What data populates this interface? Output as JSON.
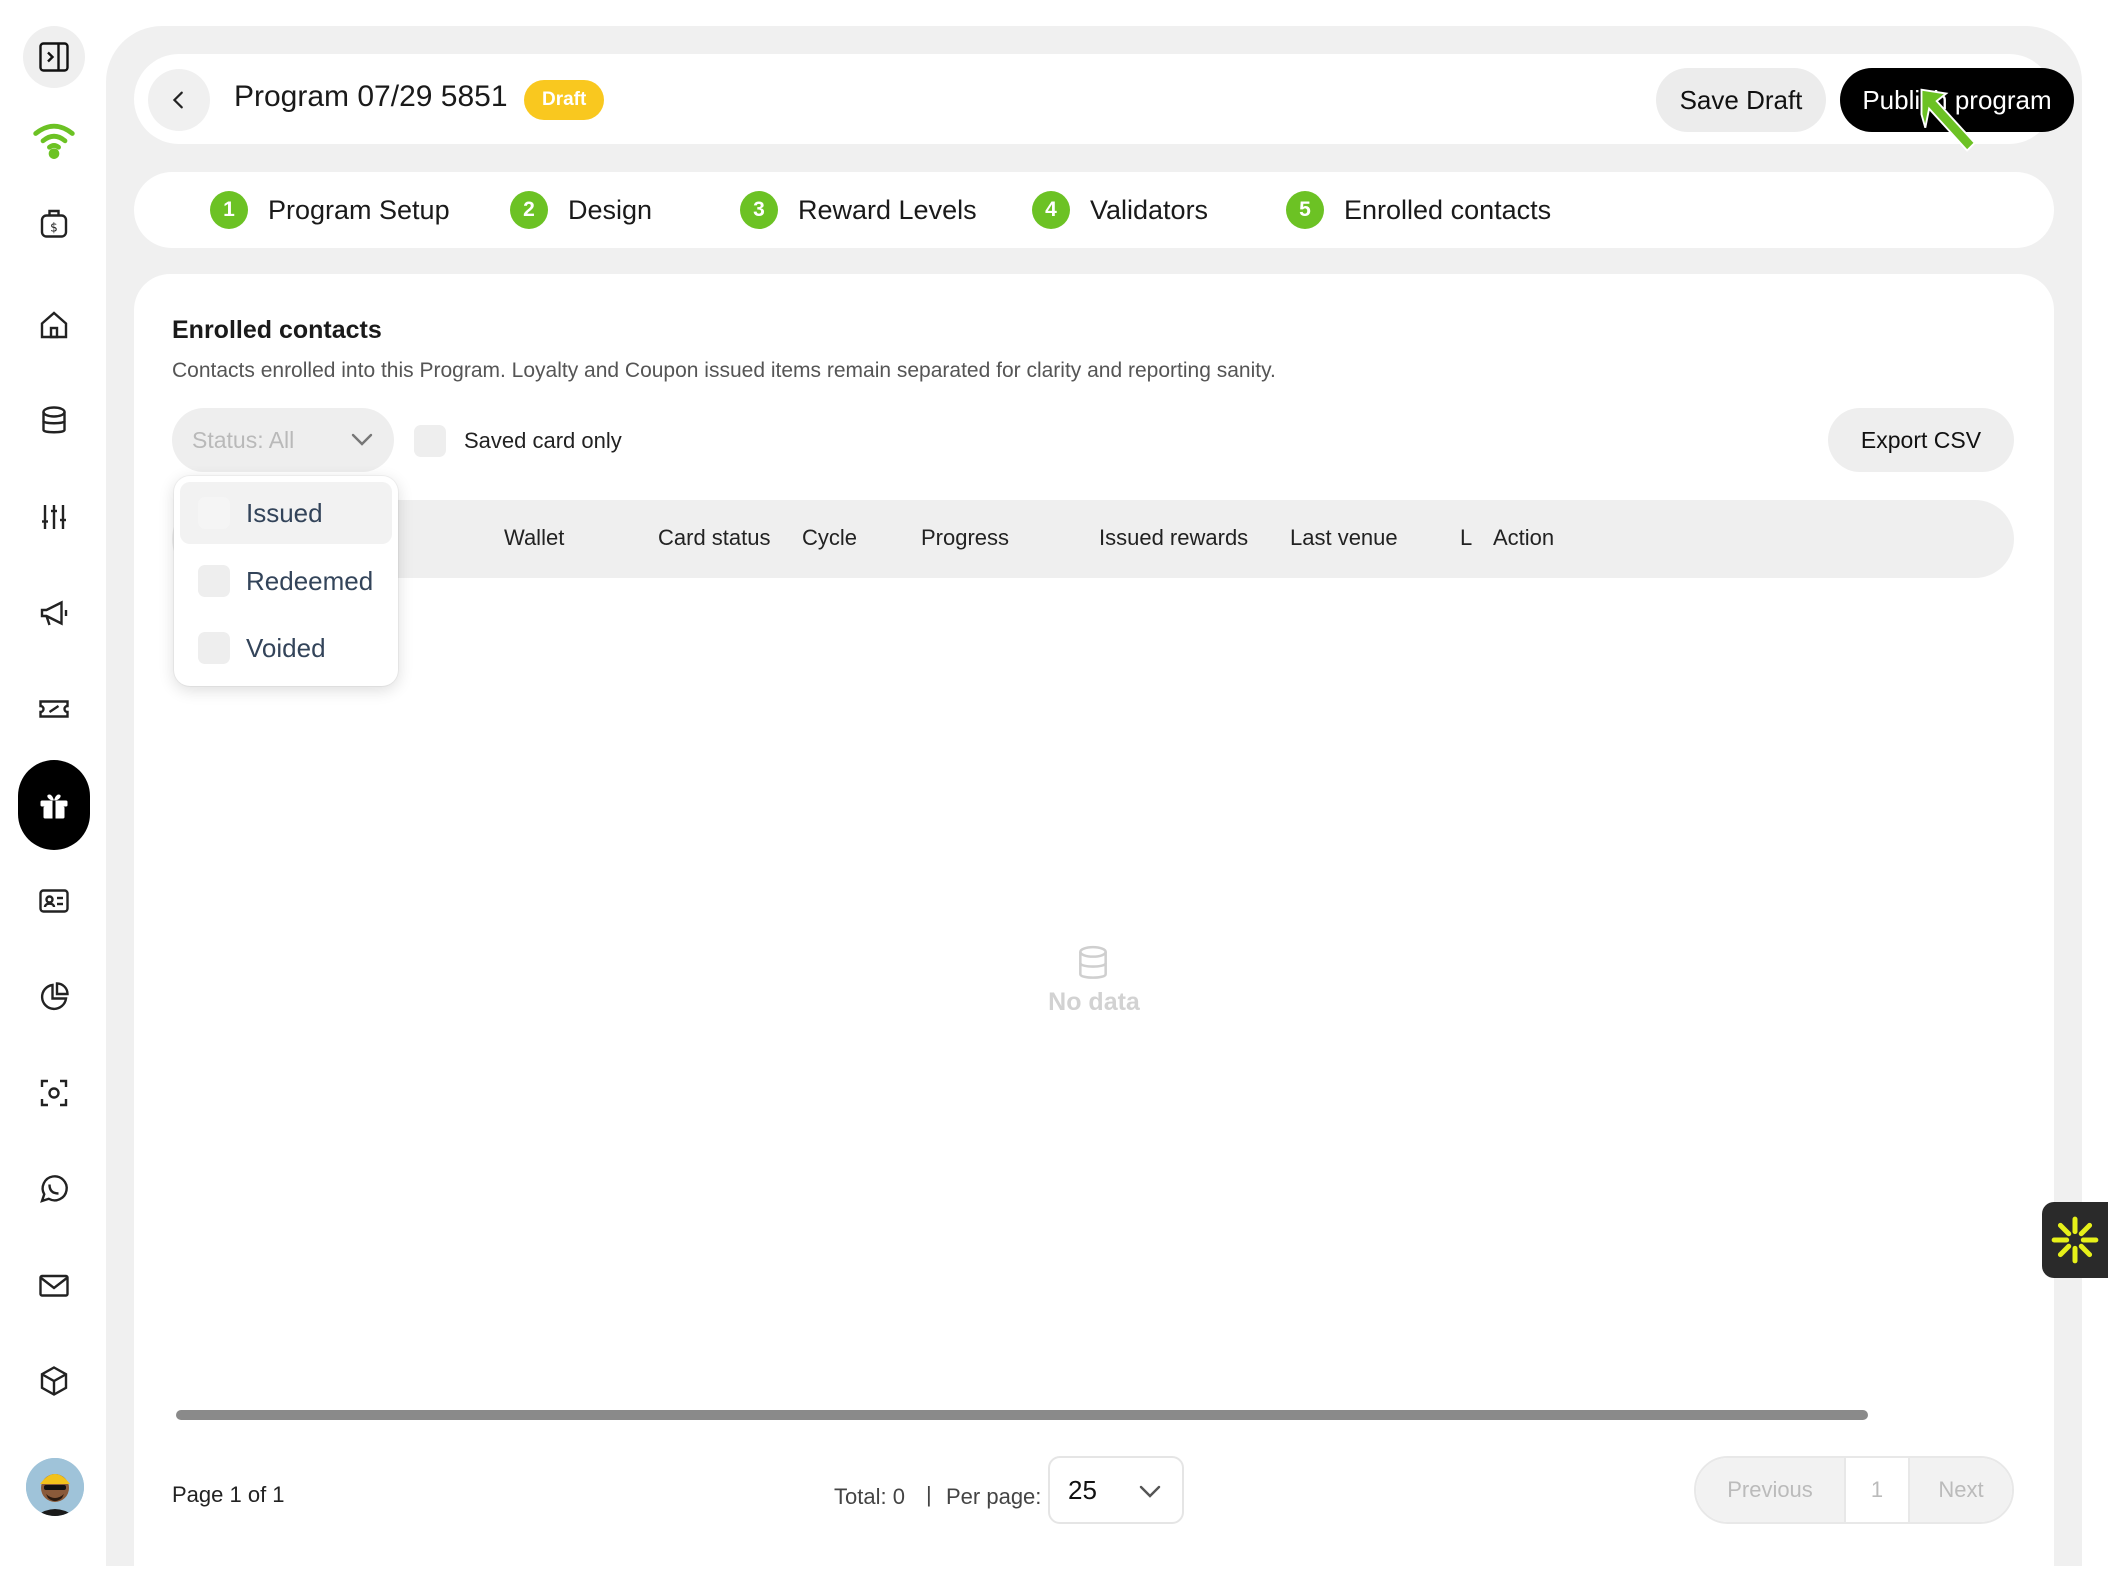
{
  "header": {
    "title": "Program 07/29 5851",
    "badge": "Draft",
    "save_draft_label": "Save Draft",
    "publish_label": "Publish program"
  },
  "steps": [
    {
      "num": "1",
      "label": "Program Setup"
    },
    {
      "num": "2",
      "label": "Design"
    },
    {
      "num": "3",
      "label": "Reward Levels"
    },
    {
      "num": "4",
      "label": "Validators"
    },
    {
      "num": "5",
      "label": "Enrolled contacts"
    }
  ],
  "content": {
    "title": "Enrolled contacts",
    "subtitle": "Contacts enrolled into this Program. Loyalty and Coupon issued items remain separated for clarity and reporting sanity.",
    "status_select": "Status: All",
    "saved_card_label": "Saved card only",
    "export_label": "Export CSV",
    "columns": [
      "Wallet",
      "Card status",
      "Cycle",
      "Progress",
      "Issued rewards",
      "Last venue",
      "L",
      "Action"
    ],
    "empty_text": "No data"
  },
  "dropdown": {
    "options": [
      "Issued",
      "Redeemed",
      "Voided"
    ]
  },
  "pagination": {
    "page_info": "Page 1 of 1",
    "total": "Total: 0",
    "separator": "|",
    "per_page_label": "Per page:",
    "per_page_value": "25",
    "previous": "Previous",
    "current": "1",
    "next": "Next"
  },
  "sidebar": {
    "icons": [
      "sidebar-toggle-icon",
      "wifi-logo-icon",
      "wallet-icon",
      "home-icon",
      "database-icon",
      "sliders-icon",
      "megaphone-icon",
      "ticket-icon",
      "gift-icon",
      "contact-card-icon",
      "pie-chart-icon",
      "scan-icon",
      "whatsapp-icon",
      "mail-icon",
      "box-icon"
    ]
  },
  "colors": {
    "accent_green": "#6cc224",
    "badge_yellow": "#f9c81f",
    "primary_black": "#000000"
  }
}
